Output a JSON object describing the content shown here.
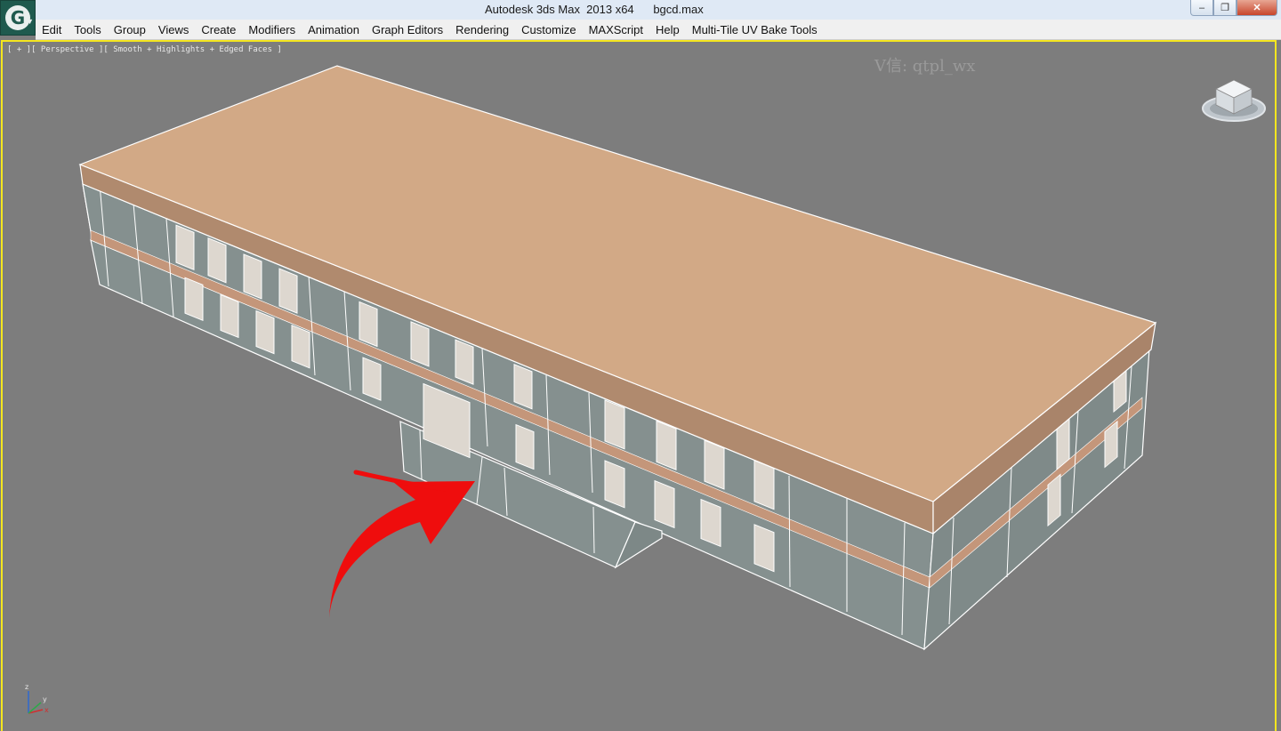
{
  "window": {
    "title": "Autodesk 3ds Max  2013 x64      bgcd.max",
    "app_icon_glyph": "G",
    "minimize_glyph": "–",
    "maximize_glyph": "❐",
    "close_glyph": "✕"
  },
  "menu": [
    {
      "id": "edit",
      "label": "Edit"
    },
    {
      "id": "tools",
      "label": "Tools"
    },
    {
      "id": "group",
      "label": "Group"
    },
    {
      "id": "views",
      "label": "Views"
    },
    {
      "id": "create",
      "label": "Create"
    },
    {
      "id": "modifiers",
      "label": "Modifiers"
    },
    {
      "id": "animation",
      "label": "Animation"
    },
    {
      "id": "graph-editors",
      "label": "Graph Editors"
    },
    {
      "id": "rendering",
      "label": "Rendering"
    },
    {
      "id": "customize",
      "label": "Customize"
    },
    {
      "id": "maxscript",
      "label": "MAXScript"
    },
    {
      "id": "help",
      "label": "Help"
    },
    {
      "id": "multi-tile",
      "label": "Multi-Tile UV Bake Tools"
    }
  ],
  "viewport": {
    "label": "[ + ][ Perspective ][ Smooth + Highlights + Edged Faces ]",
    "watermark": "V信: qtpl_wx",
    "axis_labels": {
      "x": "x",
      "y": "y",
      "z": "z"
    }
  },
  "colors": {
    "viewport_bg": "#7d7d7d",
    "active_border": "#f5e61e",
    "roof": "#d2a986",
    "roof_side": "#b08a6e",
    "wall": "#85908f",
    "band": "#c4967a",
    "edge": "#ffffff",
    "arrow": "#ef0d0d"
  }
}
